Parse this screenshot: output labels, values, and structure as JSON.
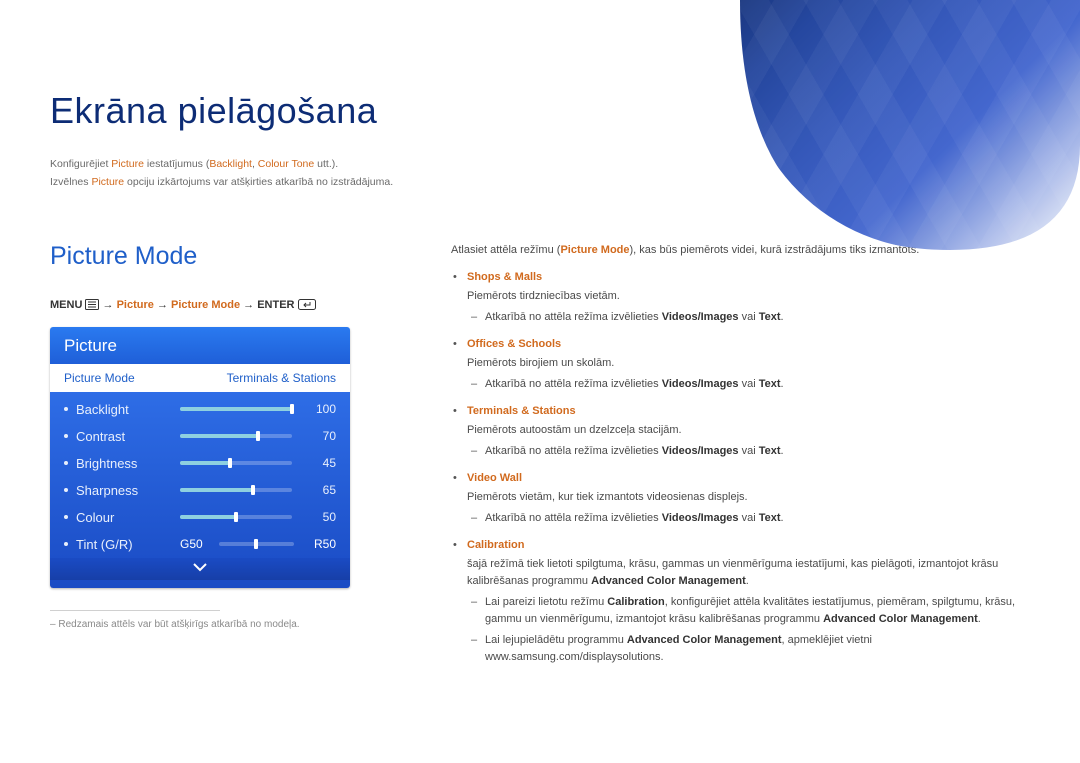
{
  "chapter_title": "Ekrāna pielāgošana",
  "intro": {
    "line1_a": "Konfigurējiet ",
    "line1_b": "Picture",
    "line1_c": " iestatījumus (",
    "line1_d": "Backlight",
    "line1_e": ", ",
    "line1_f": "Colour Tone",
    "line1_g": " utt.).",
    "line2_a": "Izvēlnes ",
    "line2_b": "Picture",
    "line2_c": " opciju izkārtojums var atšķirties atkarībā no izstrādājuma."
  },
  "section_title": "Picture Mode",
  "path": {
    "menu": "MENU",
    "arrow": "→",
    "p1": "Picture",
    "p2": "Picture Mode",
    "enter": "ENTER"
  },
  "osd": {
    "header": "Picture",
    "mode_label": "Picture Mode",
    "mode_value": "Terminals & Stations",
    "items": [
      {
        "name": "Backlight",
        "value": 100,
        "pct": 100
      },
      {
        "name": "Contrast",
        "value": 70,
        "pct": 70
      },
      {
        "name": "Brightness",
        "value": 45,
        "pct": 45
      },
      {
        "name": "Sharpness",
        "value": 65,
        "pct": 65
      },
      {
        "name": "Colour",
        "value": 50,
        "pct": 50
      }
    ],
    "tint": {
      "name": "Tint (G/R)",
      "g": "G50",
      "r": "R50"
    }
  },
  "footnote": "Redzamais attēls var būt atšķirīgs atkarībā no modeļa.",
  "right": {
    "lead_a": "Atlasiet attēla režīmu (",
    "lead_b": "Picture Mode",
    "lead_c": "), kas būs piemērots videi, kurā izstrādājums tiks izmantots.",
    "modes": [
      {
        "name": "Shops & Malls",
        "desc": "Piemērots tirdzniecības vietām.",
        "sub": [
          {
            "a": "Atkarībā no attēla režīma izvēlieties ",
            "b": "Videos/Images",
            "c": " vai ",
            "d": "Text",
            "e": "."
          }
        ]
      },
      {
        "name": "Offices & Schools",
        "desc": "Piemērots birojiem un skolām.",
        "sub": [
          {
            "a": "Atkarībā no attēla režīma izvēlieties ",
            "b": "Videos/Images",
            "c": " vai ",
            "d": "Text",
            "e": "."
          }
        ]
      },
      {
        "name": "Terminals & Stations",
        "desc": "Piemērots autoostām un dzelzceļa stacijām.",
        "sub": [
          {
            "a": "Atkarībā no attēla režīma izvēlieties ",
            "b": "Videos/Images",
            "c": " vai ",
            "d": "Text",
            "e": "."
          }
        ]
      },
      {
        "name": "Video Wall",
        "desc": "Piemērots vietām, kur tiek izmantots videosienas displejs.",
        "sub": [
          {
            "a": "Atkarībā no attēla režīma izvēlieties ",
            "b": "Videos/Images",
            "c": " vai ",
            "d": "Text",
            "e": "."
          }
        ]
      }
    ],
    "calibration": {
      "name": "Calibration",
      "desc_a": "šajā režīmā tiek lietoti spilgtuma, krāsu, gammas un vienmērīguma iestatījumi, kas pielāgoti, izmantojot krāsu kalibrēšanas programmu ",
      "desc_b": "Advanced Color Management",
      "desc_c": ".",
      "sub": [
        {
          "a": "Lai pareizi lietotu režīmu ",
          "b": "Calibration",
          "c": ", konfigurējiet attēla kvalitātes iestatījumus, piemēram, spilgtumu, krāsu, gammu un vienmērīgumu, izmantojot krāsu kalibrēšanas programmu ",
          "d": "Advanced Color Management",
          "e": "."
        },
        {
          "a": "Lai lejupielādētu programmu ",
          "b": "Advanced Color Management",
          "c": ", apmeklējiet vietni www.samsung.com/displaysolutions.",
          "d": "",
          "e": ""
        }
      ]
    }
  }
}
